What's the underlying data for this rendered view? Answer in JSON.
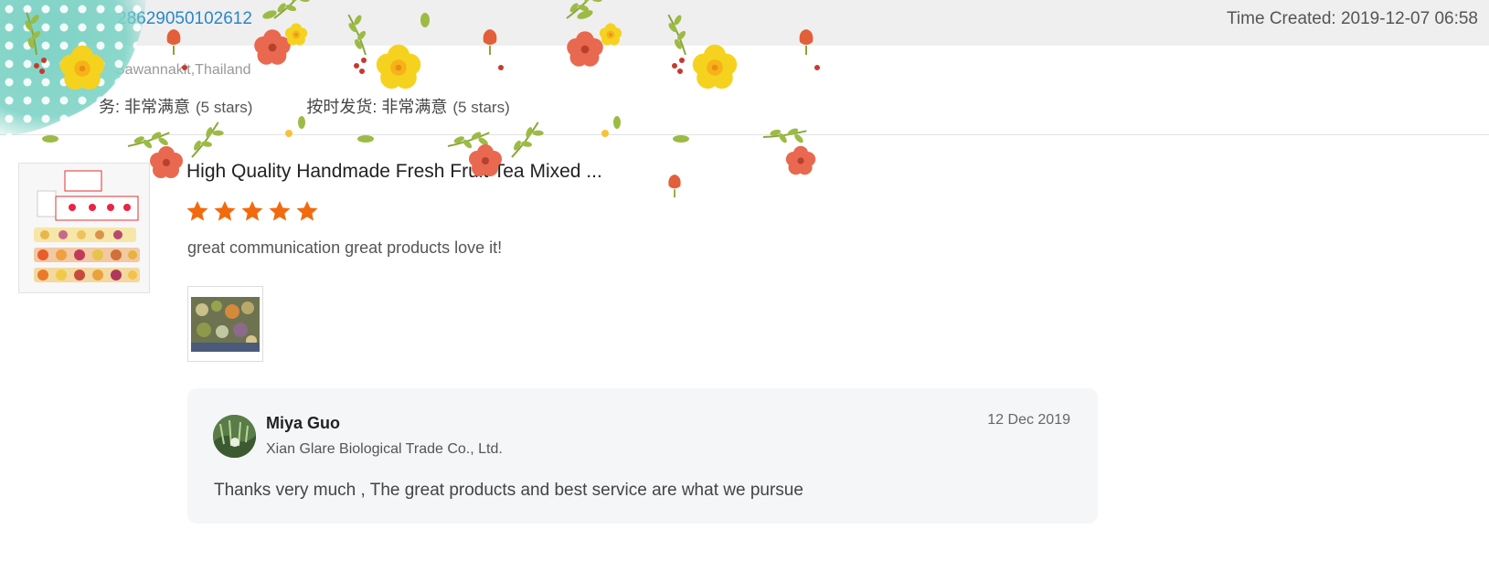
{
  "header": {
    "order_number": "28629050102612",
    "time_created": "Time Created: 2019-12-07 06:58"
  },
  "buyer": {
    "location": "Sawannakit,Thailand"
  },
  "ratings": [
    {
      "label": "务: 非常满意",
      "stars": "(5 stars)"
    },
    {
      "label": "按时发货: 非常满意",
      "stars": "(5 stars)"
    }
  ],
  "product": {
    "title": "High Quality Handmade Fresh Fruit Tea Mixed ...",
    "rating": 5,
    "review": "great communication great products love it!"
  },
  "reply": {
    "name": "Miya Guo",
    "company": "Xian Glare Biological Trade Co., Ltd.",
    "date": "12 Dec 2019",
    "text": "Thanks very much , The great products and best service are what we pursue"
  },
  "colors": {
    "link": "#2a87c8",
    "star": "#f26a0d",
    "header_bg": "#efefef",
    "reply_bg": "#f5f6f8"
  }
}
